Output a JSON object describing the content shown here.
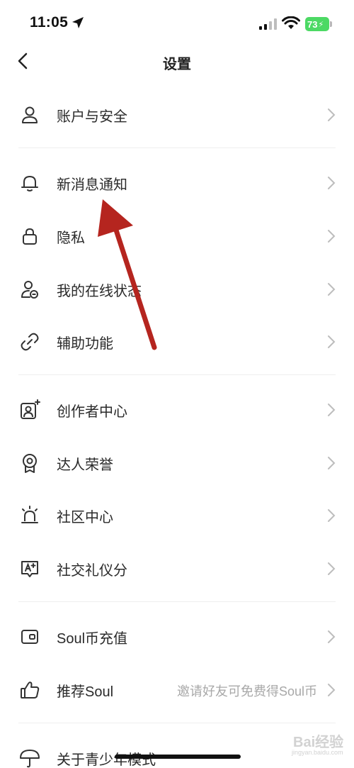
{
  "status_bar": {
    "time": "11:05",
    "battery": "73"
  },
  "nav": {
    "title": "设置"
  },
  "groups": {
    "account": {
      "label": "账户与安全"
    },
    "notify": {
      "label": "新消息通知"
    },
    "privacy": {
      "label": "隐私"
    },
    "online": {
      "label": "我的在线状态"
    },
    "assist": {
      "label": "辅助功能"
    },
    "creator": {
      "label": "创作者中心"
    },
    "honor": {
      "label": "达人荣誉"
    },
    "community": {
      "label": "社区中心"
    },
    "etiquette": {
      "label": "社交礼仪分"
    },
    "recharge": {
      "label": "Soul币充值"
    },
    "recommend": {
      "label": "推荐Soul",
      "hint": "邀请好友可免费得Soul币"
    },
    "teen": {
      "label": "关于青少年模式"
    }
  },
  "watermark": {
    "text": "Bai经验",
    "sub": "jingyan.baidu.com"
  },
  "colors": {
    "annotation_arrow": "#b5251f",
    "chevron": "#bdbdbd",
    "icon": "#333333"
  }
}
